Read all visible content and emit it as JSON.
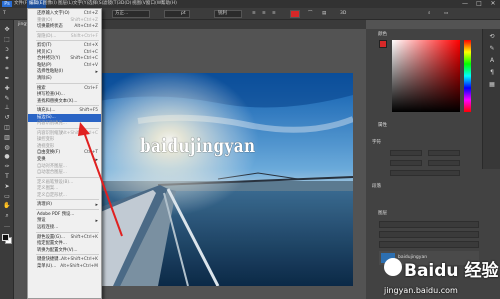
{
  "app": {
    "logo": "Ps",
    "menubar": [
      "文件(F)",
      "编辑(E)",
      "图像(I)",
      "图层(L)",
      "文字(Y)",
      "选择(S)",
      "滤镜(T)",
      "3D(D)",
      "视图(V)",
      "窗口(W)",
      "帮助(H)"
    ],
    "active_menu": "编辑(E)",
    "window_controls": [
      "—",
      "□",
      "✕"
    ]
  },
  "options_bar": {
    "font_family": "方正...",
    "font_size": "pt",
    "aa_mode": "锐利"
  },
  "document_tab": {
    "label": "jingyan.jpg @ 66.7%"
  },
  "canvas": {
    "text_layer": "baidujingyan"
  },
  "edit_menu": [
    {
      "label": "还原输入文字(O)",
      "shortcut": "Ctrl+Z",
      "state": "normal"
    },
    {
      "label": "重做(O)",
      "shortcut": "Shift+Ctrl+Z",
      "state": "disabled"
    },
    {
      "label": "切换最终状态",
      "shortcut": "Alt+Ctrl+Z",
      "state": "normal"
    },
    {
      "sep": true
    },
    {
      "label": "渐隐(D)...",
      "shortcut": "Shift+Ctrl+F",
      "state": "disabled"
    },
    {
      "sep": true
    },
    {
      "label": "剪切(T)",
      "shortcut": "Ctrl+X",
      "state": "normal"
    },
    {
      "label": "拷贝(C)",
      "shortcut": "Ctrl+C",
      "state": "normal"
    },
    {
      "label": "合并拷贝(Y)",
      "shortcut": "Shift+Ctrl+C",
      "state": "normal"
    },
    {
      "label": "粘贴(P)",
      "shortcut": "Ctrl+V",
      "state": "normal"
    },
    {
      "label": "选择性粘贴(I)",
      "shortcut": "",
      "state": "normal",
      "submenu": true
    },
    {
      "label": "清除(E)",
      "shortcut": "",
      "state": "normal"
    },
    {
      "sep": true
    },
    {
      "label": "搜索",
      "shortcut": "Ctrl+F",
      "state": "normal"
    },
    {
      "label": "拼写检查(H)...",
      "shortcut": "",
      "state": "normal"
    },
    {
      "label": "查找和替换文本(X)...",
      "shortcut": "",
      "state": "normal"
    },
    {
      "sep": true
    },
    {
      "label": "填充(L)...",
      "shortcut": "Shift+F5",
      "state": "normal"
    },
    {
      "label": "描边(S)...",
      "shortcut": "",
      "state": "highlighted"
    },
    {
      "label": "内容识别填充...",
      "shortcut": "",
      "state": "disabled"
    },
    {
      "sep": true
    },
    {
      "label": "内容识别缩放",
      "shortcut": "Alt+Shift+Ctrl+C",
      "state": "disabled"
    },
    {
      "label": "操控变形",
      "shortcut": "",
      "state": "disabled"
    },
    {
      "label": "透视变形",
      "shortcut": "",
      "state": "disabled"
    },
    {
      "label": "自由变换(F)",
      "shortcut": "Ctrl+T",
      "state": "normal"
    },
    {
      "label": "变换",
      "shortcut": "",
      "state": "normal",
      "submenu": true
    },
    {
      "label": "自动对齐图层...",
      "shortcut": "",
      "state": "disabled"
    },
    {
      "label": "自动混合图层...",
      "shortcut": "",
      "state": "disabled"
    },
    {
      "sep": true
    },
    {
      "label": "定义画笔预设(B)...",
      "shortcut": "",
      "state": "disabled"
    },
    {
      "label": "定义图案...",
      "shortcut": "",
      "state": "disabled"
    },
    {
      "label": "定义自定形状...",
      "shortcut": "",
      "state": "disabled"
    },
    {
      "sep": true
    },
    {
      "label": "清理(R)",
      "shortcut": "",
      "state": "normal",
      "submenu": true
    },
    {
      "sep": true
    },
    {
      "label": "Adobe PDF 预设...",
      "shortcut": "",
      "state": "normal"
    },
    {
      "label": "预设",
      "shortcut": "",
      "state": "normal",
      "submenu": true
    },
    {
      "label": "远程连接...",
      "shortcut": "",
      "state": "normal"
    },
    {
      "sep": true
    },
    {
      "label": "颜色设置(G)...",
      "shortcut": "Shift+Ctrl+K",
      "state": "normal"
    },
    {
      "label": "指定配置文件...",
      "shortcut": "",
      "state": "normal"
    },
    {
      "label": "转换为配置文件(V)...",
      "shortcut": "",
      "state": "normal"
    },
    {
      "sep": true
    },
    {
      "label": "键盘快捷键...",
      "shortcut": "Alt+Shift+Ctrl+K",
      "state": "normal"
    },
    {
      "label": "菜单(U)...",
      "shortcut": "Alt+Shift+Ctrl+M",
      "state": "normal"
    }
  ],
  "panels": {
    "color_tab": "颜色",
    "properties_tab": "属性",
    "character_section": "字符",
    "paragraph_section": "段落",
    "layers_tab": "图层",
    "layer_name": "baidujingyan",
    "fg_color": "#d62828"
  },
  "brand": {
    "title": "Baidu 经验",
    "url": "jingyan.baidu.com"
  }
}
